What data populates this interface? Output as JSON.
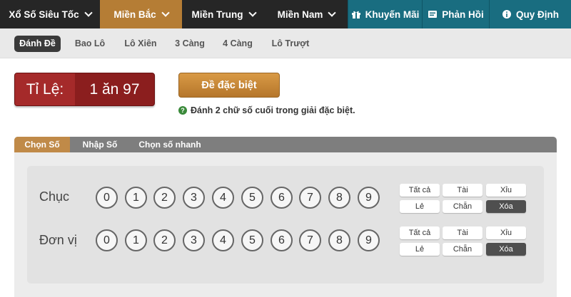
{
  "topnav": {
    "xoso": "Xổ Số Siêu Tốc",
    "mienbac": "Miền Bắc",
    "mientrung": "Miền Trung",
    "miennam": "Miền Nam",
    "khuyenmai": "Khuyến Mãi",
    "phanhoi": "Phản Hồi",
    "quydinh": "Quy Định"
  },
  "subtabs": [
    "Đánh Đề",
    "Bao Lô",
    "Lô Xiên",
    "3 Càng",
    "4 Càng",
    "Lô Trượt"
  ],
  "ratio": {
    "label": "Tỉ Lệ:",
    "value": "1 ăn 97"
  },
  "mode_button": "Đề đặc biệt",
  "hint": "Đánh 2 chữ số cuối trong giải đặc biệt.",
  "panel_tabs": [
    "Chọn Số",
    "Nhập Số",
    "Chọn số nhanh"
  ],
  "rows": [
    {
      "label": "Chục",
      "digits": [
        "0",
        "1",
        "2",
        "3",
        "4",
        "5",
        "6",
        "7",
        "8",
        "9"
      ]
    },
    {
      "label": "Đơn vị",
      "digits": [
        "0",
        "1",
        "2",
        "3",
        "4",
        "5",
        "6",
        "7",
        "8",
        "9"
      ]
    }
  ],
  "quick": {
    "all": "Tất cả",
    "big": "Tài",
    "small": "Xỉu",
    "odd": "Lẻ",
    "even": "Chẵn",
    "clear": "Xóa"
  },
  "colors": {
    "nav_active": "#b57d35",
    "nav_right": "#196d80",
    "ratio": "#8b1e1e",
    "gold": "#c58836"
  }
}
